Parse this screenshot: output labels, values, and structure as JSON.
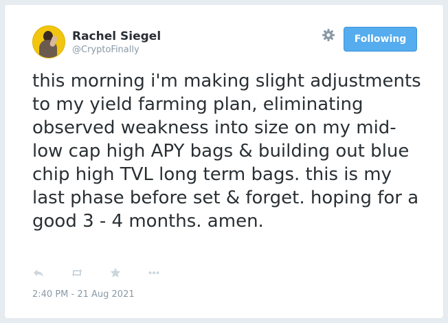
{
  "user": {
    "name": "Rachel Siegel",
    "handle": "@CryptoFinally"
  },
  "follow_button": {
    "label": "Following"
  },
  "tweet": {
    "text": "this morning i'm making slight adjustments to my yield farming plan, eliminating observed weakness into size on my mid-low cap high APY bags & building out blue chip high TVL long term bags. this is my last phase before set & forget. hoping for a good 3 - 4 months. amen.",
    "timestamp": "2:40 PM - 21 Aug 2021"
  },
  "colors": {
    "accent": "#55acee",
    "text": "#292f33",
    "muted": "#8899a6",
    "icon": "#ccd6dd"
  },
  "icons": [
    "settings-gear-icon",
    "reply-icon",
    "retweet-icon",
    "like-star-icon",
    "more-dots-icon"
  ]
}
